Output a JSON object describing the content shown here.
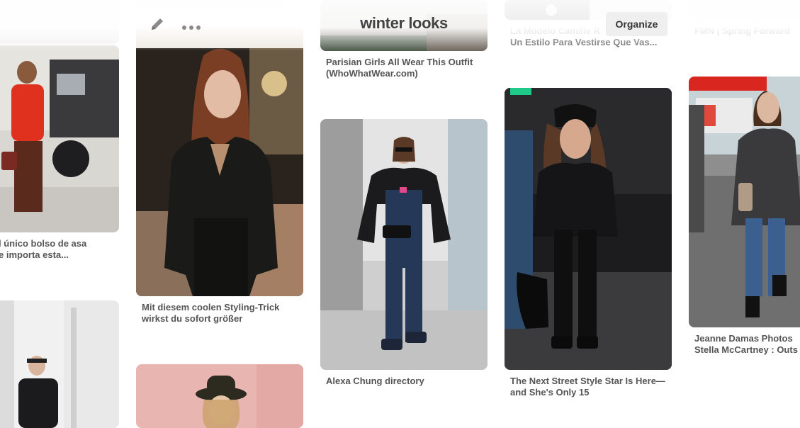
{
  "board": {
    "title": "winter looks",
    "organize_label": "Organize"
  },
  "icons": {
    "edit": "pencil-icon",
    "more": "more-dots-icon"
  },
  "captions": {
    "col1_pin1": "l único bolso de asa\ne importa esta...",
    "col2_pin1": "Mit diesem coolen Styling-Trick wirkst du sofort größer",
    "col3_pin0": "Parisian Girls All Wear This Outfit (WhoWhatWear.com)",
    "col3_pin1": "Alexa Chung directory",
    "col4_pin0_line1": "La Modelo Camille R",
    "col4_pin0_line2": "Un Estilo Para Vestirse Que Vas...",
    "col4_pin1": "The Next Street Style Star Is Here—and She's Only 15",
    "col5_pin0": "FMN | Spring Forward",
    "col5_pin1": "Jeanne Damas Photos\nStella McCartney : Outs"
  },
  "colors": {
    "accent": "#efefef",
    "caption": "#555555",
    "title": "#444444"
  }
}
